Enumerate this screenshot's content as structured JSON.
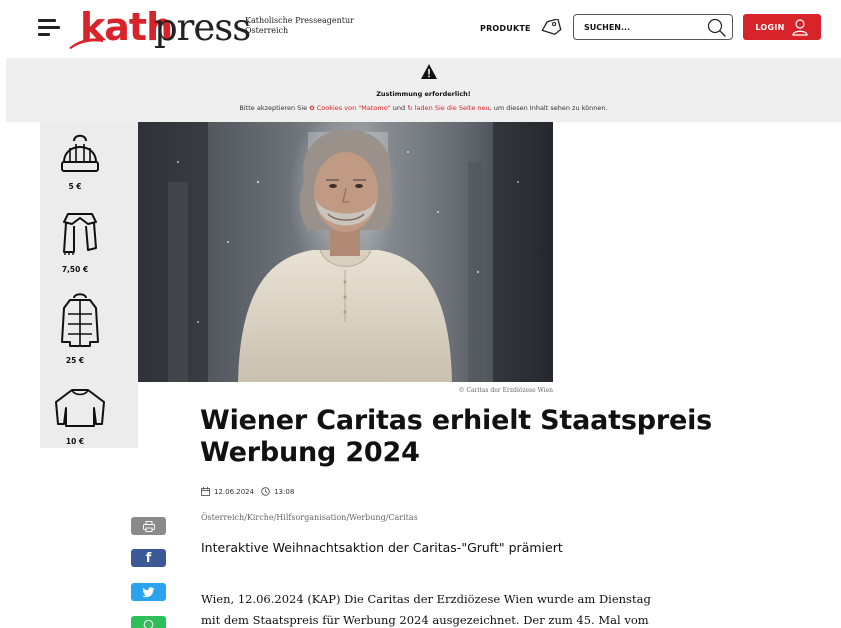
{
  "header": {
    "logo_kath": "kath",
    "logo_press": "press",
    "tagline_line1": "Katholische Presseagentur",
    "tagline_line2": "Österreich",
    "produkte_label": "PRODUKTE",
    "search_placeholder": "SUCHEN...",
    "login_label": "LOGIN"
  },
  "consent": {
    "title": "Zustimmung erforderlich!",
    "text_part1": "Bitte akzeptieren Sie",
    "link_cookies": "Cookies von \"Matomo\"",
    "text_part2": "und",
    "link_reload": "laden Sie die Seite neu",
    "text_part3": ", um diesen Inhalt sehen zu können."
  },
  "hero": {
    "prices": [
      "5 €",
      "7,50 €",
      "25 €",
      "10 €"
    ],
    "caption": "© Caritas der Erzdiözese Wien"
  },
  "article": {
    "headline_line1": "Wiener Caritas erhielt Staatspreis",
    "headline_line2": "Werbung 2024",
    "date": "12.06.2024",
    "time": "13:08",
    "categories": "Österreich/Kirche/Hilfsorganisation/Werbung/Caritas",
    "subtitle": "Interaktive Weihnachtsaktion der Caritas-\"Gruft\" prämiert",
    "body_line1": "Wien, 12.06.2024 (KAP) Die Caritas der Erzdiözese Wien wurde am Dienstag",
    "body_line2": "mit dem Staatspreis für Werbung 2024 ausgezeichnet. Der zum 45. Mal vom"
  },
  "colors": {
    "brand_red": "#d8232a",
    "facebook": "#3b5998",
    "twitter": "#2aa3ef",
    "whatsapp": "#2fbf5a",
    "print": "#8a8a8a"
  }
}
